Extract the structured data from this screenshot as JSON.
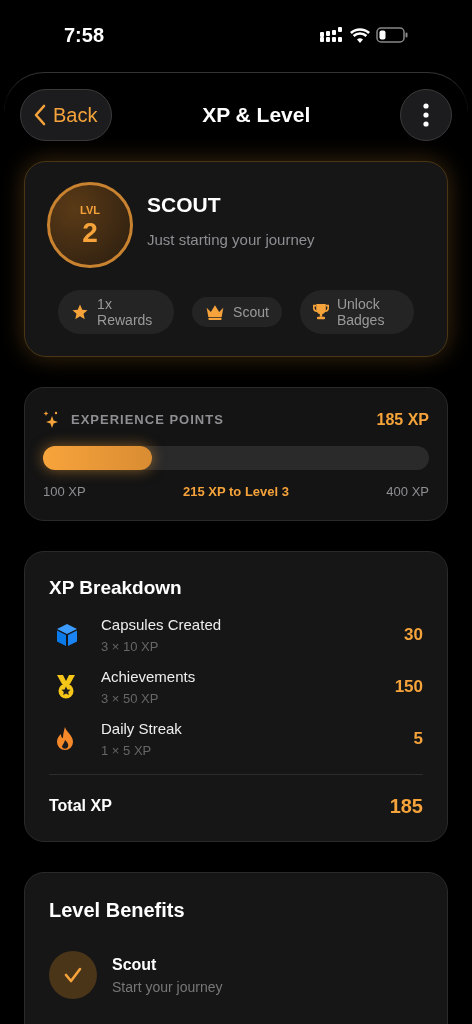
{
  "status_bar": {
    "time": "7:58"
  },
  "header": {
    "back": "Back",
    "title": "XP & Level"
  },
  "level_card": {
    "badge_label": "LVL",
    "level": "2",
    "rank": "SCOUT",
    "subtitle": "Just starting your journey",
    "perks": [
      {
        "kind": "star",
        "label": "1x Rewards"
      },
      {
        "kind": "crown",
        "label": "Scout"
      },
      {
        "kind": "trophy",
        "label": "Unlock Badges"
      }
    ]
  },
  "experience": {
    "title": "EXPERIENCE POINTS",
    "value": "185 XP",
    "level": 0.283,
    "min": "100 XP",
    "to_next": "215 XP to Level 3",
    "max": "400 XP"
  },
  "breakdown": {
    "title": "XP Breakdown",
    "rows": [
      {
        "kind": "cube",
        "label": "Capsules Created",
        "detail": "3 × 10 XP",
        "value": "30"
      },
      {
        "kind": "medal",
        "label": "Achievements",
        "detail": "3 × 50 XP",
        "value": "150"
      },
      {
        "kind": "flame",
        "label": "Daily Streak",
        "detail": "1 × 5 XP",
        "value": "5"
      }
    ],
    "total_label": "Total XP",
    "total_value": "185"
  },
  "benefits": {
    "title": "Level Benefits",
    "items": [
      {
        "name": "Scout",
        "description": "Start your journey",
        "unlocked": true
      }
    ]
  }
}
